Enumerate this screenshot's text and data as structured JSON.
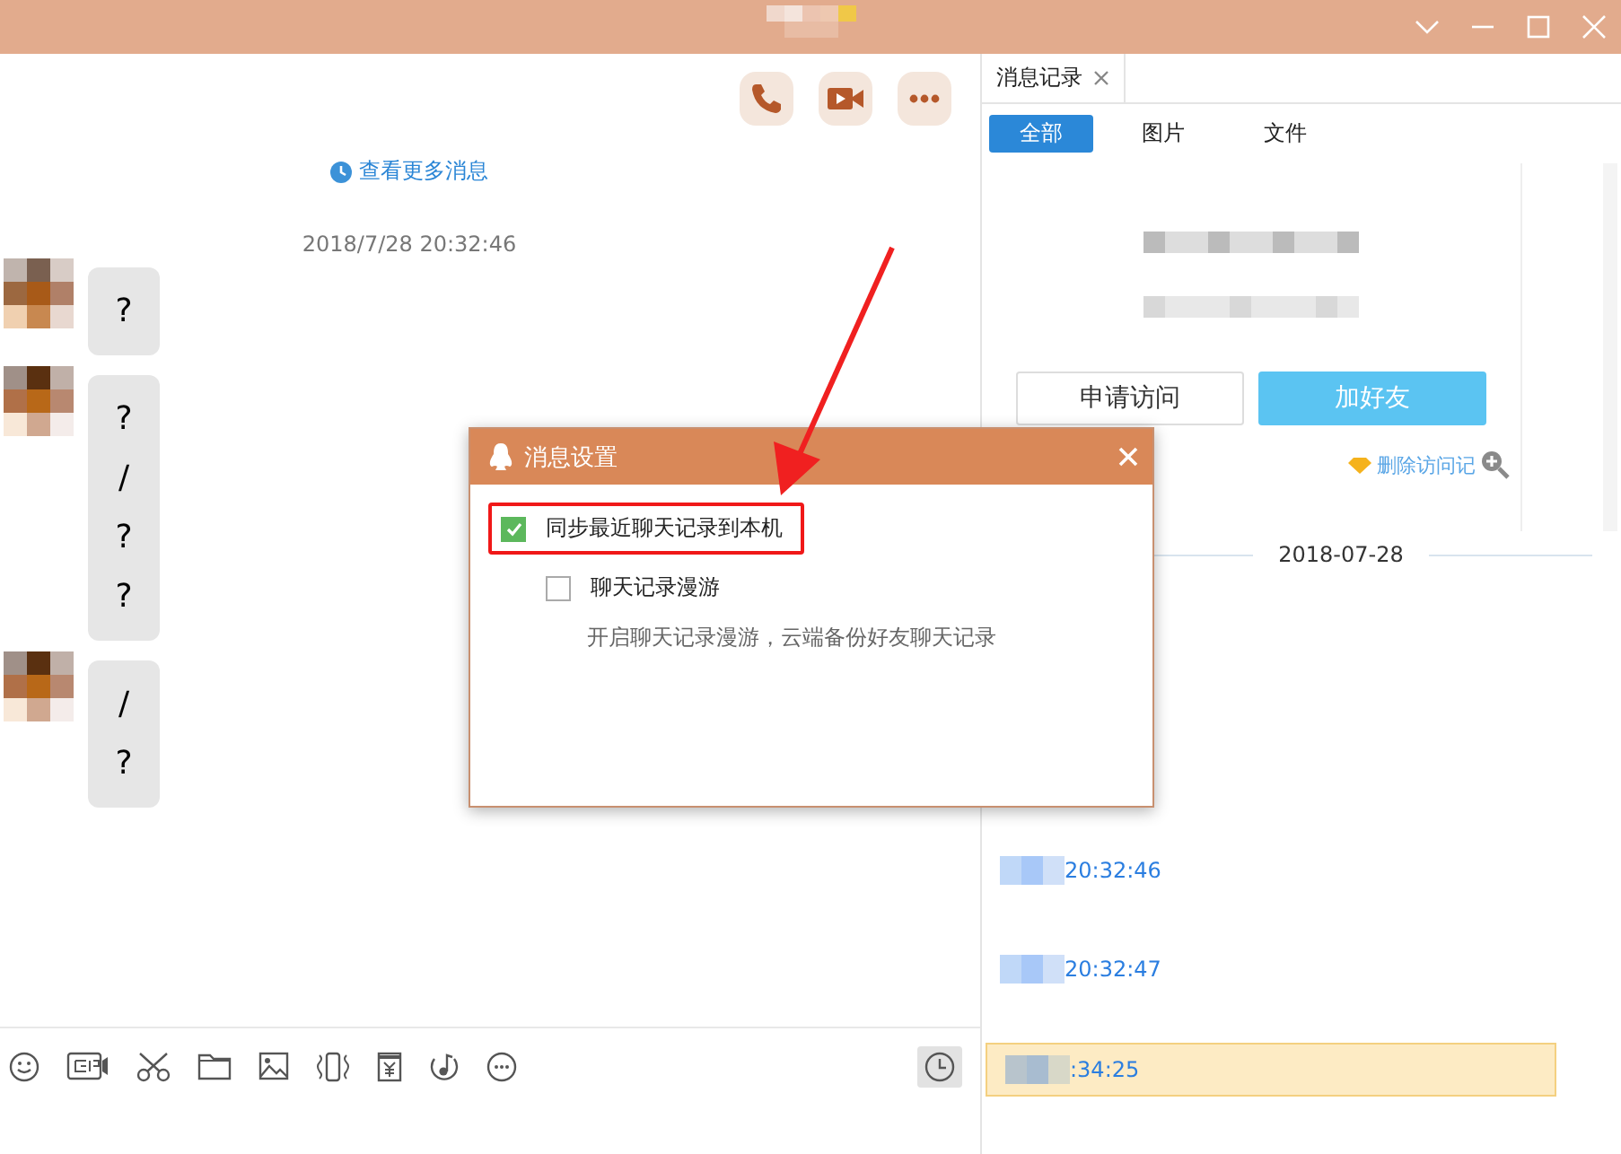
{
  "window": {
    "title_blurred": true
  },
  "chat": {
    "more_link": "查看更多消息",
    "timestamp": "2018/7/28 20:32:46",
    "messages": [
      {
        "text": "?"
      },
      {
        "text": "?\n/\n?\n?"
      },
      {
        "text": "/\n?"
      }
    ]
  },
  "history_panel": {
    "tab": "消息记录",
    "filters": [
      {
        "label": "全部",
        "selected": true
      },
      {
        "label": "图片",
        "selected": false
      },
      {
        "label": "文件",
        "selected": false
      }
    ],
    "buttons": [
      "申请访问",
      "加好友"
    ],
    "delete_link": "删除访问记",
    "date": "2018-07-28",
    "entries": [
      {
        "time": "20:32:46",
        "selected": false
      },
      {
        "time": "20:32:47",
        "selected": false
      },
      {
        "time": ":34:25",
        "selected": true
      }
    ]
  },
  "dialog": {
    "title": "消息设置",
    "options": [
      {
        "label": "同步最近聊天记录到本机",
        "checked": true,
        "indented": false,
        "highlighted": true
      },
      {
        "label": "聊天记录漫游",
        "checked": false,
        "indented": true,
        "highlighted": false,
        "description": "开启聊天记录漫游，云端备份好友聊天记录"
      }
    ]
  }
}
